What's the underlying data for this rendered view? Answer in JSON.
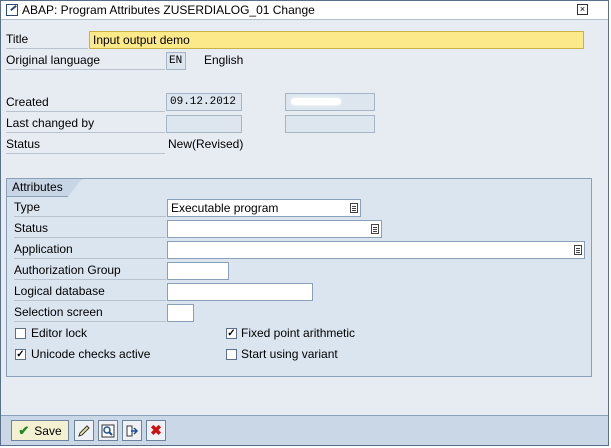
{
  "window": {
    "title": "ABAP: Program Attributes ZUSERDIALOG_01 Change"
  },
  "header": {
    "title_label": "Title",
    "title_value": "Input output demo",
    "orig_lang_label": "Original language",
    "orig_lang_code": "EN",
    "orig_lang_name": "English",
    "created_label": "Created",
    "created_date": "09.12.2012",
    "last_changed_label": "Last changed by",
    "status_label": "Status",
    "status_value": "New(Revised)"
  },
  "attributes": {
    "group_title": "Attributes",
    "type_label": "Type",
    "type_value": "Executable program",
    "status_label": "Status",
    "application_label": "Application",
    "auth_group_label": "Authorization Group",
    "logical_db_label": "Logical database",
    "selection_screen_label": "Selection screen",
    "editor_lock_label": "Editor lock",
    "editor_lock_checked": false,
    "fixed_point_label": "Fixed point arithmetic",
    "fixed_point_checked": true,
    "unicode_label": "Unicode checks active",
    "unicode_checked": true,
    "start_variant_label": "Start using variant",
    "start_variant_checked": false
  },
  "toolbar": {
    "save_label": "Save"
  }
}
